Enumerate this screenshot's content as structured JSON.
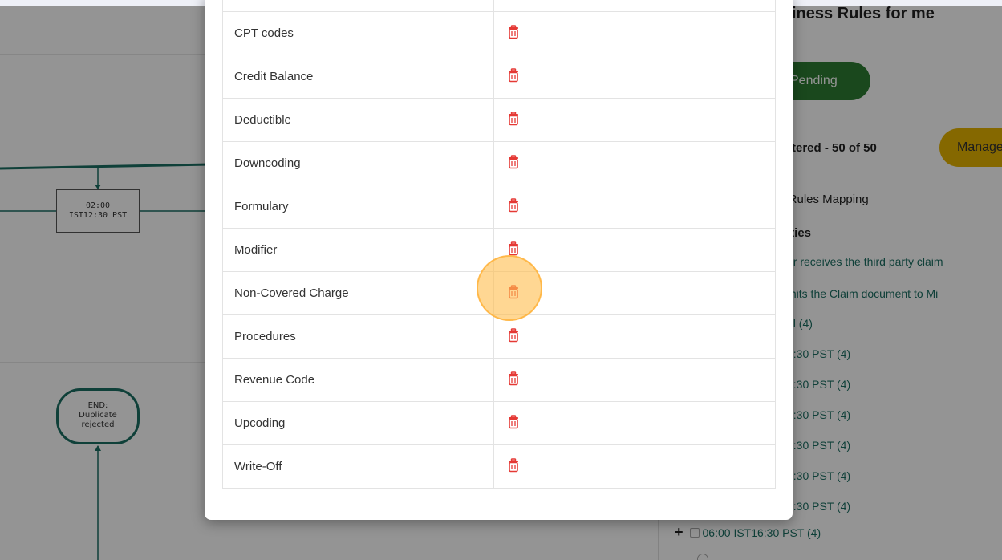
{
  "background_canvas": {
    "box_node": {
      "line1": "02:00",
      "line2": "IST12:30 PST"
    },
    "end_node": {
      "line1": "END:",
      "line2": "Duplicate",
      "line3": "rejected"
    },
    "connector_color": "#1b6e62"
  },
  "side_panel": {
    "title": "iness Rules for me",
    "pending_label": "Pending",
    "filtered_text": "tered - 50 of 50",
    "manage_label": "Manage",
    "mapping_label": "s Rules Mapping",
    "responsibilities_label": "lties",
    "tasks": [
      "er receives the third party claim",
      "mits the Claim document to Mi"
    ],
    "tree_items": [
      {
        "label": "al",
        "count": "(4)"
      },
      {
        "label": "8:30 PST",
        "count": "(4)"
      },
      {
        "label": "4:30 PST",
        "count": "(4)"
      },
      {
        "label": "3:30 PST",
        "count": "(4)"
      },
      {
        "label": "7:30 PST",
        "count": "(4)"
      },
      {
        "label": "8:30 PST",
        "count": "(4)"
      },
      {
        "label": "9:30 PST",
        "count": "(4)"
      }
    ],
    "tree_last": {
      "plus": "+",
      "label": "06:00 IST16:30 PST",
      "count": "(4)"
    }
  },
  "modal": {
    "rules": [
      "CPT codes",
      "Credit Balance",
      "Deductible",
      "Downcoding",
      "Formulary",
      "Modifier",
      "Non-Covered Charge",
      "Procedures",
      "Revenue Code",
      "Upcoding",
      "Write-Off"
    ],
    "delete_icon": "trash-icon",
    "delete_icon_color": "#e53935"
  },
  "colors": {
    "accent_teal": "#1b6e62",
    "pending_green": "#2e7d32",
    "manage_yellow": "#e5b300",
    "click_highlight": "#ffbe50"
  }
}
